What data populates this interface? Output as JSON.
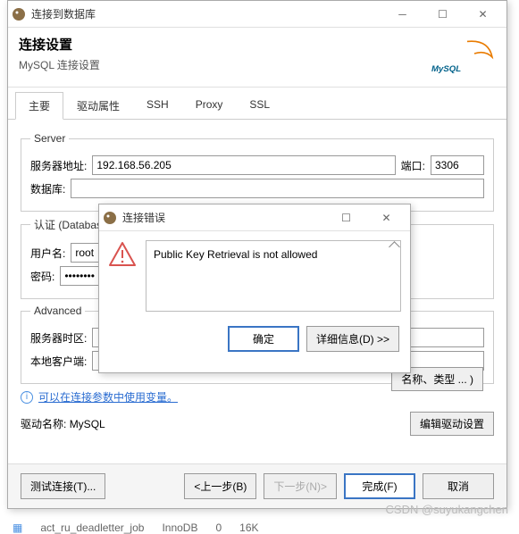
{
  "main": {
    "title": "连接到数据库",
    "header_title": "连接设置",
    "header_sub": "MySQL 连接设置",
    "logo_text": "MySQL",
    "tabs": {
      "main": "主要",
      "driver": "驱动属性",
      "ssh": "SSH",
      "proxy": "Proxy",
      "ssl": "SSL"
    },
    "server": {
      "legend": "Server",
      "host_label": "服务器地址:",
      "host_value": "192.168.56.205",
      "port_label": "端口:",
      "port_value": "3306",
      "db_label": "数据库:",
      "db_value": ""
    },
    "auth": {
      "legend": "认证 (Database Native)",
      "user_label": "用户名:",
      "user_value": "root",
      "pass_label": "密码:",
      "pass_value": "••••••••"
    },
    "advanced": {
      "legend": "Advanced",
      "tz_label": "服务器时区:",
      "local_label": "本地客户端:"
    },
    "link_text": "可以在连接参数中使用变量。",
    "edit_columns": "名称、类型 ... )",
    "driver_row": {
      "label": "驱动名称:",
      "value": "MySQL",
      "edit_btn": "编辑驱动设置"
    },
    "footer": {
      "test": "测试连接(T)...",
      "back": "<上一步(B)",
      "next": "下一步(N)>",
      "finish": "完成(F)",
      "cancel": "取消"
    }
  },
  "error": {
    "title": "连接错误",
    "message": "Public Key Retrieval is not allowed",
    "ok": "确定",
    "details": "详细信息(D) >>"
  },
  "bg_row": {
    "name": "act_ru_deadletter_job",
    "engine": "InnoDB",
    "rows": "0",
    "size": "16K"
  },
  "watermark": "CSDN @suyukangchen"
}
